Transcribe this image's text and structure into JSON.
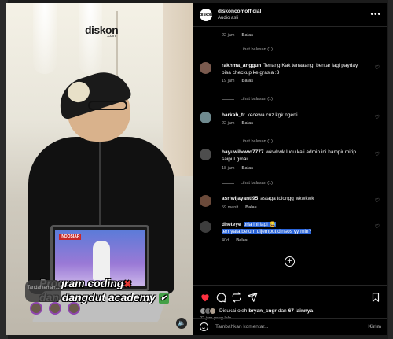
{
  "post": {
    "owner": "diskoncomofficial",
    "owner_avatar_text": "diskon",
    "audio": "Audio asli",
    "media_watermark": "diskon",
    "media_watermark_sub": ".com",
    "media_caption_line1": "Program coding",
    "media_caption_line2": "dan dangdut academy",
    "media_tag_prompt": "Tandai teman...",
    "laptop_channel": "INDOSIAR"
  },
  "comments_top": {
    "meta_time": "22 jam",
    "meta_reply": "Balas",
    "view_replies": "Lihat balasan (1)"
  },
  "comments": [
    {
      "user": "rakhma_anggun",
      "text": "Tenang Kak tenaaang, bentar lagi payday bisa checkup ke grasia :3",
      "time": "19 jam",
      "reply": "Balas",
      "view_replies": "Lihat balasan (1)",
      "avatar_color": "#7a5a4e"
    },
    {
      "user": "barkah_tr",
      "text": "kecewa cuz kgk ngerti",
      "time": "22 jam",
      "reply": "Balas",
      "view_replies": "Lihat balasan (1)",
      "avatar_color": "#6f8a8f"
    },
    {
      "user": "bayuwibowo7777",
      "text": "wkwkwk lucu kali admin ini hampir mirip saipul gmail",
      "time": "18 jam",
      "reply": "Balas",
      "view_replies": "Lihat balasan (1)",
      "avatar_color": "#4d4d4d"
    },
    {
      "user": "asriwijayanti95",
      "text": "astaga tolongg wkwkwk",
      "time": "59 menit",
      "reply": "Balas",
      "avatar_color": "#6b4a3a"
    },
    {
      "user": "dheteye",
      "text_line1": "pria ini lagi 😂",
      "text_line2": "ternyata belum dijemput dinsos yy min?",
      "time": "40d",
      "reply": "Balas",
      "avatar_color": "#3d3d3d"
    }
  ],
  "likes": {
    "prefix": "Disukai oleh",
    "user": "bryan_sngr",
    "joiner": "dan",
    "others": "67 lainnya",
    "ago": "22 jam yang lalu"
  },
  "composer": {
    "placeholder": "Tambahkan komentar...",
    "post_label": "Kirim"
  },
  "colors": {
    "like_red": "#ff3040",
    "highlight": "#2a64d8",
    "panel_bg": "#000000"
  },
  "icons": [
    "more-icon",
    "heart-icon",
    "comment-icon",
    "share-icon",
    "send-icon",
    "bookmark-icon",
    "add-circle-icon",
    "smile-icon",
    "mute-icon"
  ]
}
